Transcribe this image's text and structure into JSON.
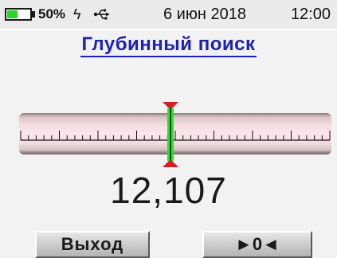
{
  "status": {
    "battery_percent_text": "50%",
    "battery_level": 0.5,
    "date": "6 июн 2018",
    "time": "12:00",
    "icons": [
      "battery-icon",
      "lightning-icon",
      "usb-icon"
    ],
    "battery_color": "#28d428"
  },
  "screen": {
    "title": "Глубинный поиск",
    "value": "12,107",
    "title_color": "#1e22b0",
    "indicator_color": "#2be22b",
    "marker_color": "#d42020"
  },
  "buttons": {
    "exit_label": "Выход",
    "zero_label": "►0◄"
  }
}
